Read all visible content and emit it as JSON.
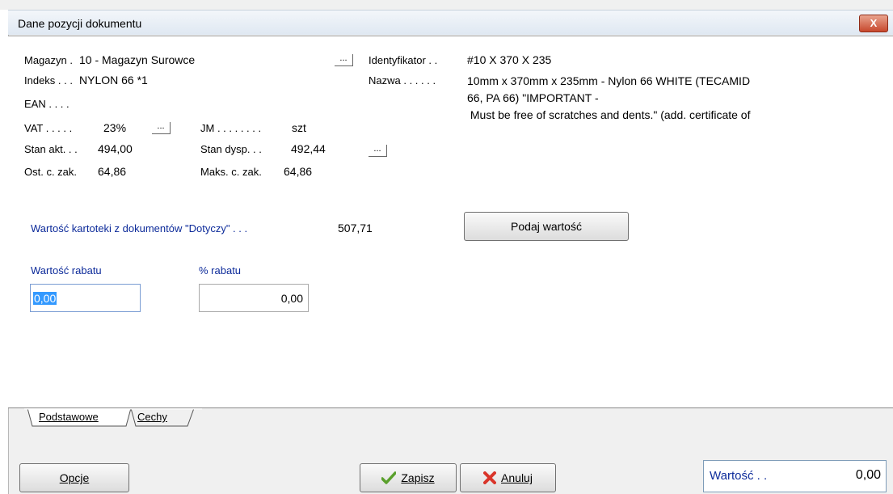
{
  "window": {
    "title": "Dane pozycji dokumentu",
    "close_label": "X"
  },
  "header": {
    "magazyn_label": "Magazyn .",
    "magazyn_value": "10 - Magazyn Surowce",
    "indeks_label": "Indeks . . .",
    "indeks_value": "NYLON 66 *1",
    "ean_label": "EAN . . . .",
    "vat_label": "VAT . . . . .",
    "vat_value": "23%",
    "jm_label": "JM . . . . . . . .",
    "jm_value": "szt",
    "stan_akt_label": "Stan akt. . .",
    "stan_akt_value": "494,00",
    "stan_dysp_label": "Stan dysp. . .",
    "stan_dysp_value": "492,44",
    "ost_label": "Ost. c. zak.",
    "ost_value": "64,86",
    "maks_label": "Maks. c. zak.",
    "maks_value": "64,86",
    "ident_label": "Identyfikator . .",
    "ident_value": "#10 X 370 X 235",
    "nazwa_label": "Nazwa . . . . . .",
    "nazwa_lines": [
      "10mm x 370mm x 235mm  - Nylon 66 WHITE (TECAMID",
      "66, PA 66)  \"IMPORTANT -",
      " Must be free of scratches and dents.\" (add. certificate of"
    ],
    "dots_label": "..."
  },
  "main": {
    "wartosc_kartoteki_label": "Wartość kartoteki z dokumentów \"Dotyczy\" . . .",
    "wartosc_kartoteki_value": "507,71",
    "podaj_button": "Podaj wartość",
    "rabat_label": "Wartość rabatu",
    "rabat_value": "0,00",
    "proc_rabatu_label": "% rabatu",
    "proc_rabatu_value": "0,00"
  },
  "tabs": [
    "Podstawowe",
    "Cechy"
  ],
  "footer": {
    "opcje": "Opcje",
    "zapisz": "Zapisz",
    "anuluj": "Anuluj",
    "wartosc_label": "Wartość . .",
    "wartosc_value": "0,00"
  }
}
